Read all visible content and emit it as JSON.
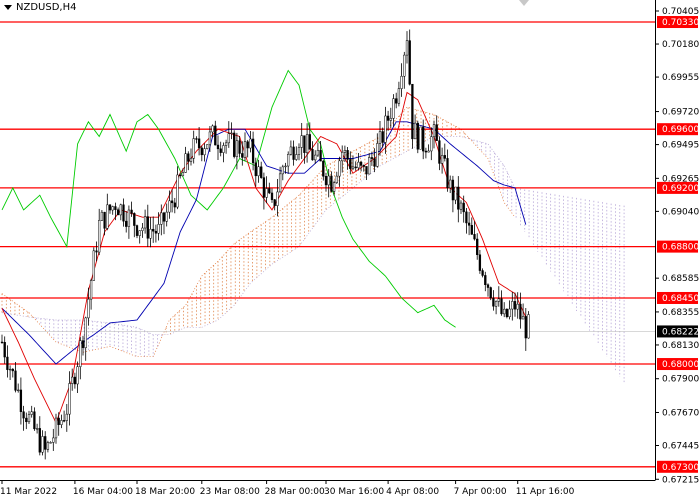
{
  "chart_data": {
    "type": "line",
    "symbol": "NZDUSD,H4",
    "price_axis": {
      "labels": [
        "0.70405",
        "0.70180",
        "0.69955",
        "0.69720",
        "0.69495",
        "0.69265",
        "0.69040",
        "0.68585",
        "0.68355",
        "0.68130",
        "0.67900",
        "0.67670",
        "0.67445",
        "0.67215"
      ],
      "ylim": [
        0.6721,
        0.7048
      ]
    },
    "time_axis": {
      "labels": [
        "11 Mar 2022",
        "16 Mar 04:00",
        "18 Mar 20:00",
        "23 Mar 08:00",
        "28 Mar 00:00",
        "30 Mar 16:00",
        "4 Apr 08:00",
        "7 Apr 00:00",
        "11 Apr 16:00"
      ],
      "label_bar_index": [
        0,
        27,
        50,
        74,
        98,
        120,
        143,
        168,
        191
      ]
    },
    "levels": [
      {
        "value": 0.7033,
        "label": "0.70330"
      },
      {
        "value": 0.696,
        "label": "0.69600"
      },
      {
        "value": 0.692,
        "label": "0.69200"
      },
      {
        "value": 0.688,
        "label": "0.68800"
      },
      {
        "value": 0.6845,
        "label": "0.68450"
      },
      {
        "value": 0.68,
        "label": "0.68000"
      },
      {
        "value": 0.673,
        "label": "0.67300"
      }
    ],
    "current_price": {
      "value": 0.68222,
      "label": "0.68222"
    },
    "series": [
      {
        "kind": "close",
        "x": [
          0,
          8,
          16,
          24,
          30,
          36,
          42,
          50,
          58,
          64,
          70,
          78,
          84,
          92,
          100,
          104,
          110,
          118,
          122,
          126,
          130,
          134,
          140,
          146,
          150,
          152,
          156,
          160,
          166,
          170,
          174,
          180,
          186,
          190,
          194
        ],
        "values": [
          0.6815,
          0.677,
          0.674,
          0.677,
          0.682,
          0.6895,
          0.691,
          0.6895,
          0.689,
          0.6915,
          0.6945,
          0.6955,
          0.695,
          0.6945,
          0.6905,
          0.6935,
          0.6955,
          0.6935,
          0.6925,
          0.6945,
          0.6935,
          0.693,
          0.695,
          0.6985,
          0.7025,
          0.696,
          0.695,
          0.6955,
          0.692,
          0.6905,
          0.6885,
          0.6855,
          0.683,
          0.684,
          0.6825
        ]
      },
      {
        "kind": "tenkan",
        "color": "#e00000",
        "x": [
          0,
          6,
          12,
          20,
          26,
          32,
          38,
          44,
          52,
          58,
          66,
          72,
          80,
          88,
          94,
          100,
          106,
          112,
          118,
          124,
          130,
          138,
          146,
          150,
          154,
          160,
          166,
          172,
          178,
          184,
          190,
          194
        ],
        "values": [
          0.6838,
          0.6815,
          0.679,
          0.676,
          0.679,
          0.685,
          0.689,
          0.6905,
          0.69,
          0.69,
          0.693,
          0.6945,
          0.696,
          0.6955,
          0.692,
          0.6905,
          0.6925,
          0.694,
          0.6955,
          0.695,
          0.693,
          0.694,
          0.6955,
          0.6985,
          0.698,
          0.6955,
          0.692,
          0.691,
          0.6885,
          0.6855,
          0.6848,
          0.6832
        ]
      },
      {
        "kind": "kijun",
        "color": "#0000b0",
        "x": [
          0,
          10,
          20,
          30,
          34,
          40,
          50,
          60,
          66,
          72,
          78,
          84,
          90,
          98,
          106,
          112,
          118,
          124,
          130,
          140,
          146,
          150,
          154,
          160,
          166,
          176,
          182,
          186,
          190,
          194
        ],
        "values": [
          0.6838,
          0.682,
          0.68,
          0.6815,
          0.682,
          0.6828,
          0.683,
          0.6855,
          0.689,
          0.6912,
          0.6955,
          0.696,
          0.696,
          0.6935,
          0.693,
          0.693,
          0.694,
          0.694,
          0.694,
          0.6945,
          0.6965,
          0.6965,
          0.6963,
          0.696,
          0.695,
          0.6935,
          0.6925,
          0.6922,
          0.692,
          0.6895
        ]
      },
      {
        "kind": "chikou",
        "color": "#00cc00",
        "x": [
          0,
          4,
          8,
          14,
          18,
          24,
          28,
          32,
          36,
          40,
          46,
          50,
          54,
          58,
          64,
          70,
          76,
          82,
          88,
          94,
          100,
          106,
          110,
          114,
          118,
          122,
          126,
          130,
          136,
          142,
          148,
          154,
          160,
          164,
          168
        ],
        "values": [
          0.6905,
          0.692,
          0.6905,
          0.6915,
          0.69,
          0.688,
          0.695,
          0.6965,
          0.6955,
          0.697,
          0.6945,
          0.6965,
          0.697,
          0.696,
          0.694,
          0.6915,
          0.6905,
          0.692,
          0.694,
          0.6935,
          0.6975,
          0.7,
          0.699,
          0.696,
          0.695,
          0.692,
          0.69,
          0.6885,
          0.687,
          0.686,
          0.6845,
          0.6835,
          0.684,
          0.683,
          0.6825
        ]
      },
      {
        "kind": "span_a",
        "color": "#e07030",
        "x": [
          0,
          10,
          20,
          30,
          40,
          50,
          56,
          62,
          68,
          74,
          80,
          86,
          92,
          100,
          110,
          120,
          130,
          140,
          150,
          160,
          170,
          180,
          186,
          190
        ],
        "values": [
          0.6848,
          0.6835,
          0.6815,
          0.6808,
          0.6812,
          0.6805,
          0.6805,
          0.683,
          0.684,
          0.686,
          0.687,
          0.6882,
          0.689,
          0.69,
          0.6915,
          0.6935,
          0.6945,
          0.6955,
          0.6975,
          0.697,
          0.696,
          0.694,
          0.691,
          0.69
        ]
      },
      {
        "kind": "span_b",
        "color": "#b0a0d0",
        "x": [
          0,
          10,
          20,
          30,
          40,
          50,
          56,
          62,
          68,
          74,
          80,
          86,
          92,
          100,
          110,
          120,
          130,
          140,
          150,
          160,
          170,
          180,
          186,
          190
        ],
        "values": [
          0.6835,
          0.6832,
          0.683,
          0.683,
          0.6828,
          0.6825,
          0.682,
          0.682,
          0.6825,
          0.6825,
          0.683,
          0.684,
          0.6855,
          0.6868,
          0.688,
          0.6905,
          0.692,
          0.6935,
          0.6945,
          0.6955,
          0.6955,
          0.695,
          0.6935,
          0.692
        ]
      }
    ],
    "candles_count": 196
  }
}
